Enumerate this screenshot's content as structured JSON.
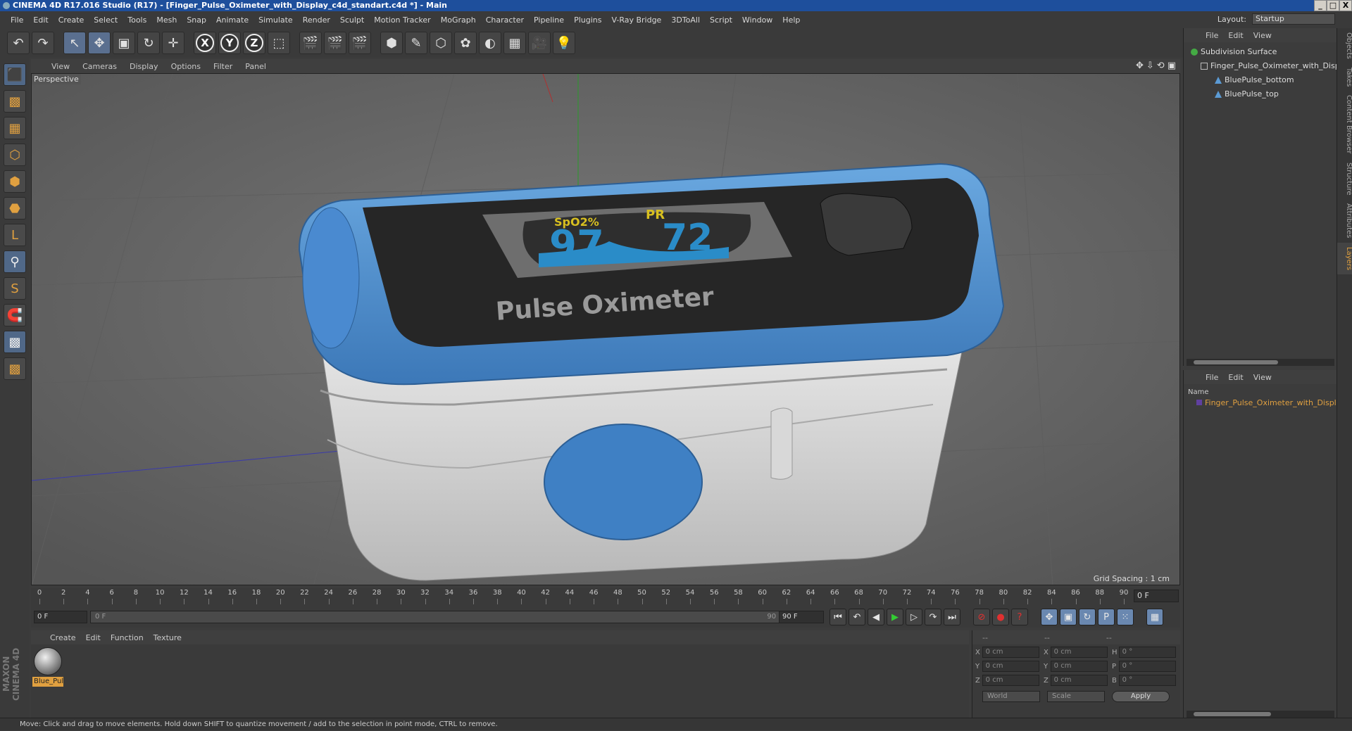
{
  "window": {
    "title": "CINEMA 4D R17.016 Studio (R17) - [Finger_Pulse_Oximeter_with_Display_c4d_standart.c4d *] - Main",
    "controls": [
      "_",
      "□",
      "X"
    ]
  },
  "menu": [
    "File",
    "Edit",
    "Create",
    "Select",
    "Tools",
    "Mesh",
    "Snap",
    "Animate",
    "Simulate",
    "Render",
    "Sculpt",
    "Motion Tracker",
    "MoGraph",
    "Character",
    "Pipeline",
    "Plugins",
    "V-Ray Bridge",
    "3DToAll",
    "Script",
    "Window",
    "Help"
  ],
  "layout": {
    "label": "Layout:",
    "value": "Startup"
  },
  "toolbar": {
    "undo": "↶",
    "redo": "↷",
    "select": "↖",
    "move": "✥",
    "scale": "▣",
    "rotate": "↻",
    "place": "✛",
    "x": "X",
    "y": "Y",
    "z": "Z",
    "coord": "⬚",
    "render_view": "🎬",
    "render_pv": "🎬",
    "render_settings": "🎬",
    "cube": "⬢",
    "pen": "✎",
    "subdiv": "⬡",
    "cloner": "✿",
    "deformer": "◐",
    "floor": "▦",
    "camera": "🎥",
    "light": "💡"
  },
  "lefttools": [
    "⬛",
    "▩",
    "▦",
    "⬡",
    "⬢",
    "⬣",
    "L",
    "⚲",
    "S",
    "🧲",
    "▩",
    "▩"
  ],
  "viewport": {
    "menu": [
      "View",
      "Cameras",
      "Display",
      "Options",
      "Filter",
      "Panel"
    ],
    "label": "Perspective",
    "grid_spacing": "Grid Spacing : 1 cm",
    "icons": [
      "✥",
      "⇩",
      "⟲",
      "▣"
    ],
    "device_text": "Pulse Oximeter",
    "spo2_label": "SpO2%",
    "pr_label": "PR",
    "spo2_value": "97",
    "pr_value": "72"
  },
  "timeline": {
    "ticks": [
      "0",
      "2",
      "4",
      "6",
      "8",
      "10",
      "12",
      "14",
      "16",
      "18",
      "20",
      "22",
      "24",
      "26",
      "28",
      "30",
      "32",
      "34",
      "36",
      "38",
      "40",
      "42",
      "44",
      "46",
      "48",
      "50",
      "52",
      "54",
      "56",
      "58",
      "60",
      "62",
      "64",
      "66",
      "68",
      "70",
      "72",
      "74",
      "76",
      "78",
      "80",
      "82",
      "84",
      "86",
      "88",
      "90"
    ],
    "current_frame": "0 F"
  },
  "transport": {
    "start_field": "0 F",
    "slider_left": "0 F",
    "slider_right": "90 F",
    "end_field": "90 F",
    "buttons": [
      "⏮",
      "↶",
      "◀",
      "▶",
      "▷",
      "↷",
      "⏭"
    ],
    "key_buttons": [
      "⊘",
      "●",
      "?"
    ],
    "mode_buttons": [
      "✥",
      "▣",
      "↻",
      "P",
      "⁙"
    ],
    "film": "▦"
  },
  "material": {
    "menu": [
      "Create",
      "Edit",
      "Function",
      "Texture"
    ],
    "item": "Blue_Pul"
  },
  "brand": "MAXON CINEMA 4D",
  "coords": {
    "head": [
      "--",
      "--",
      "--"
    ],
    "rows": [
      {
        "l1": "X",
        "v1": "0 cm",
        "l2": "X",
        "v2": "0 cm",
        "l3": "H",
        "v3": "0 °"
      },
      {
        "l1": "Y",
        "v1": "0 cm",
        "l2": "Y",
        "v2": "0 cm",
        "l3": "P",
        "v3": "0 °"
      },
      {
        "l1": "Z",
        "v1": "0 cm",
        "l2": "Z",
        "v2": "0 cm",
        "l3": "B",
        "v3": "0 °"
      }
    ],
    "world": "World",
    "scale": "Scale",
    "apply": "Apply"
  },
  "status": "Move: Click and drag to move elements. Hold down SHIFT to quantize movement / add to the selection in point mode, CTRL to remove.",
  "objects": {
    "menu": [
      "File",
      "Edit",
      "View"
    ],
    "items": [
      "Subdivision Surface",
      "Finger_Pulse_Oximeter_with_Displa",
      "BluePulse_bottom",
      "BluePulse_top"
    ]
  },
  "layers": {
    "menu": [
      "File",
      "Edit",
      "View"
    ],
    "column": "Name",
    "item": "Finger_Pulse_Oximeter_with_Display"
  },
  "sidetabs": [
    "Objects",
    "Takes",
    "Content Browser",
    "Structure",
    "Attributes",
    "Layers"
  ]
}
